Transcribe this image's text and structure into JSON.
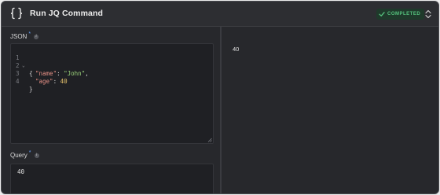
{
  "node": {
    "title": "Run JQ Command",
    "status": "COMPLETED",
    "icon": "curly-braces-icon"
  },
  "colors": {
    "accent_required": "#6aa5ff",
    "status_green": "#56c37e",
    "status_bg": "#1f3a2b"
  },
  "json_field": {
    "label": "JSON",
    "required_marker": "*",
    "info": "i",
    "lines": [
      {
        "num": "1",
        "fold": "⌄",
        "text": "{"
      },
      {
        "num": "2",
        "key": "\"name\"",
        "sep": ": ",
        "value": "\"John\"",
        "value_type": "string",
        "tail": ","
      },
      {
        "num": "3",
        "key": "\"age\"",
        "sep": ": ",
        "value": "40",
        "value_type": "number",
        "tail": ""
      },
      {
        "num": "4",
        "text": "}"
      }
    ]
  },
  "query_field": {
    "label": "Query",
    "required_marker": "*",
    "info": "i",
    "value": "40"
  },
  "output": {
    "value": "40"
  }
}
